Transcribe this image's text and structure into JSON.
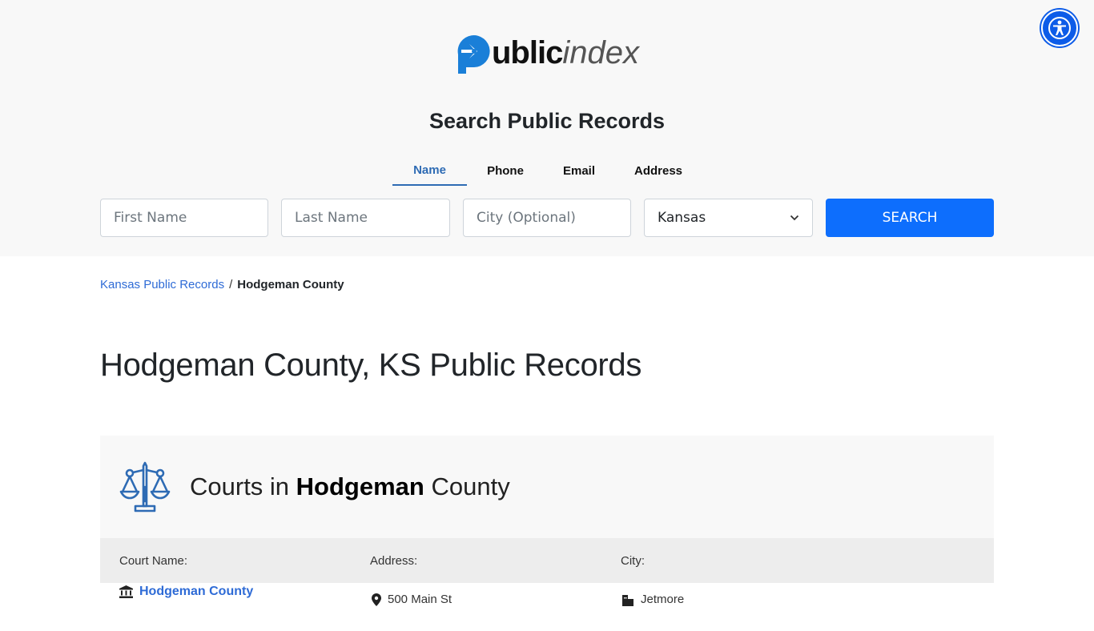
{
  "brand": {
    "logo_bold": "ublic",
    "logo_light": "index",
    "logo_color": "#1a7fd8"
  },
  "accessibility": {
    "label": "Accessibility"
  },
  "hero": {
    "title": "Search Public Records",
    "tabs": [
      {
        "label": "Name",
        "active": true
      },
      {
        "label": "Phone",
        "active": false
      },
      {
        "label": "Email",
        "active": false
      },
      {
        "label": "Address",
        "active": false
      }
    ],
    "form": {
      "first_name_placeholder": "First Name",
      "last_name_placeholder": "Last Name",
      "city_placeholder": "City (Optional)",
      "state_selected": "Kansas",
      "search_label": "SEARCH"
    }
  },
  "breadcrumb": {
    "parent": "Kansas Public Records",
    "separator": "/",
    "current": "Hodgeman County"
  },
  "page_title": "Hodgeman County, KS Public Records",
  "courts": {
    "title_prefix": "Courts in",
    "title_county": "Hodgeman",
    "title_suffix": "County",
    "columns": [
      "Court Name:",
      "Address:",
      "City:"
    ],
    "rows": [
      {
        "name": "Hodgeman County",
        "address": "500 Main St",
        "city": "Jetmore"
      }
    ]
  },
  "colors": {
    "accent": "#0d6efd",
    "tab_active": "#2e6bb4",
    "link": "#2e6bd6"
  }
}
